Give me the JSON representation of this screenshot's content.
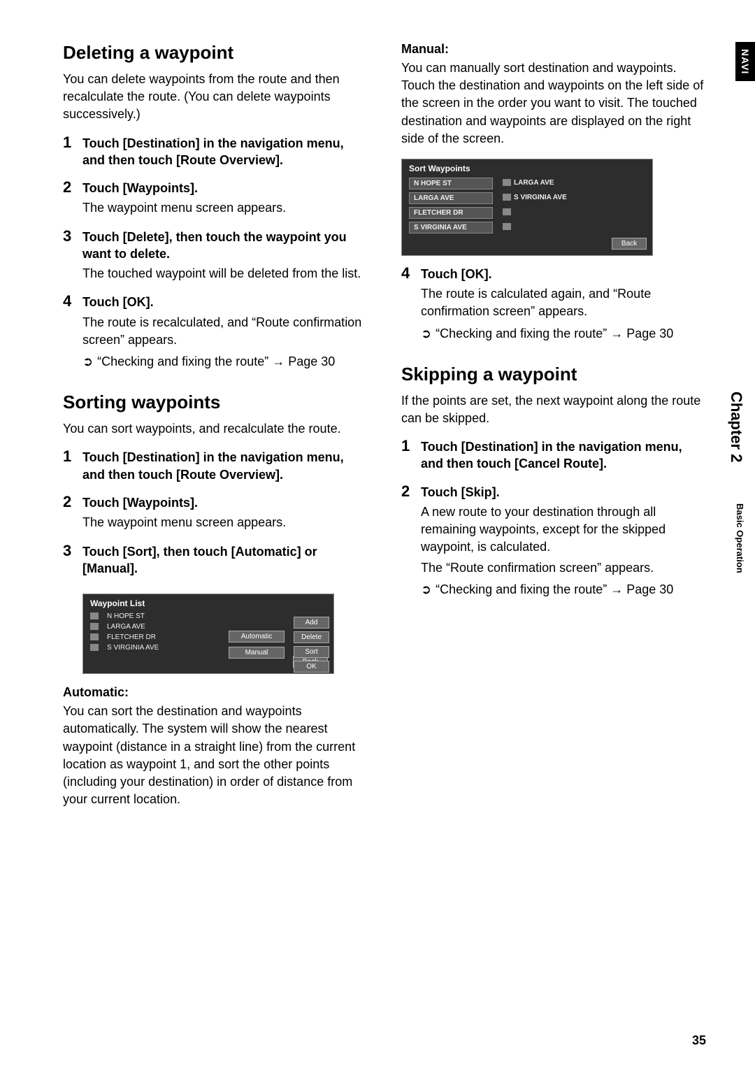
{
  "side": {
    "navi": "NAVI",
    "chapter": "Chapter 2",
    "basic": "Basic Operation"
  },
  "pagenum": "35",
  "left": {
    "h_delete": "Deleting a waypoint",
    "p_delete": "You can delete waypoints from the route and then recalculate the route. (You can delete waypoints successively.)",
    "del_steps": [
      {
        "head": "Touch [Destination] in the navigation menu, and then touch [Route Overview]."
      },
      {
        "head": "Touch [Waypoints].",
        "body": "The waypoint menu screen appears."
      },
      {
        "head": "Touch [Delete], then touch the waypoint you want to delete.",
        "body": "The touched waypoint will be deleted from the list."
      },
      {
        "head": "Touch [OK].",
        "body": "The route is recalculated, and “Route confirmation screen” appears.",
        "xref": "“Checking and fixing the route” → Page 30"
      }
    ],
    "h_sort": "Sorting waypoints",
    "p_sort": "You can sort waypoints, and recalculate the route.",
    "sort_steps": [
      {
        "head": "Touch [Destination] in the navigation menu, and then touch [Route Overview]."
      },
      {
        "head": "Touch [Waypoints].",
        "body": "The waypoint menu screen appears."
      },
      {
        "head": "Touch [Sort], then touch [Automatic] or [Manual]."
      }
    ],
    "auto_head": "Automatic:",
    "auto_body": "You can sort the destination and waypoints automatically. The system will show the nearest waypoint (distance in a straight line) from the current location as waypoint 1, and sort the other points (including your destination) in order of distance from your current location."
  },
  "right": {
    "manual_head": "Manual:",
    "manual_body": "You can manually sort destination and waypoints. Touch the destination and waypoints on the left side of the screen in the order you want to visit. The touched destination and waypoints are displayed on the right side of the screen.",
    "sort_ok": {
      "head": "Touch [OK].",
      "body": "The route is calculated again, and “Route confirmation screen” appears.",
      "xref": "“Checking and fixing the route” → Page 30"
    },
    "h_skip": "Skipping a waypoint",
    "p_skip": "If the points are set, the next waypoint along the route can be skipped.",
    "skip_steps": [
      {
        "head": "Touch [Destination] in the navigation menu, and then touch [Cancel Route]."
      },
      {
        "head": "Touch [Skip].",
        "body": "A new route to your destination through all remaining waypoints, except for the skipped waypoint, is calculated.",
        "body2": "The “Route confirmation screen” appears.",
        "xref": "“Checking and fixing the route” → Page 30"
      }
    ]
  },
  "ui1": {
    "title": "Waypoint List",
    "rows": [
      "N HOPE ST",
      "LARGA AVE",
      "FLETCHER DR",
      "S VIRGINIA AVE"
    ],
    "btns": [
      "Add",
      "Delete",
      "Sort",
      "OK"
    ],
    "popup": [
      "Automatic",
      "Manual"
    ],
    "back": "Back"
  },
  "ui2": {
    "title": "Sort Waypoints",
    "left_rows": [
      "N HOPE ST",
      "LARGA AVE",
      "FLETCHER DR",
      "S VIRGINIA AVE"
    ],
    "right_rows": [
      "LARGA AVE",
      "S VIRGINIA AVE",
      "",
      ""
    ],
    "back": "Back"
  }
}
